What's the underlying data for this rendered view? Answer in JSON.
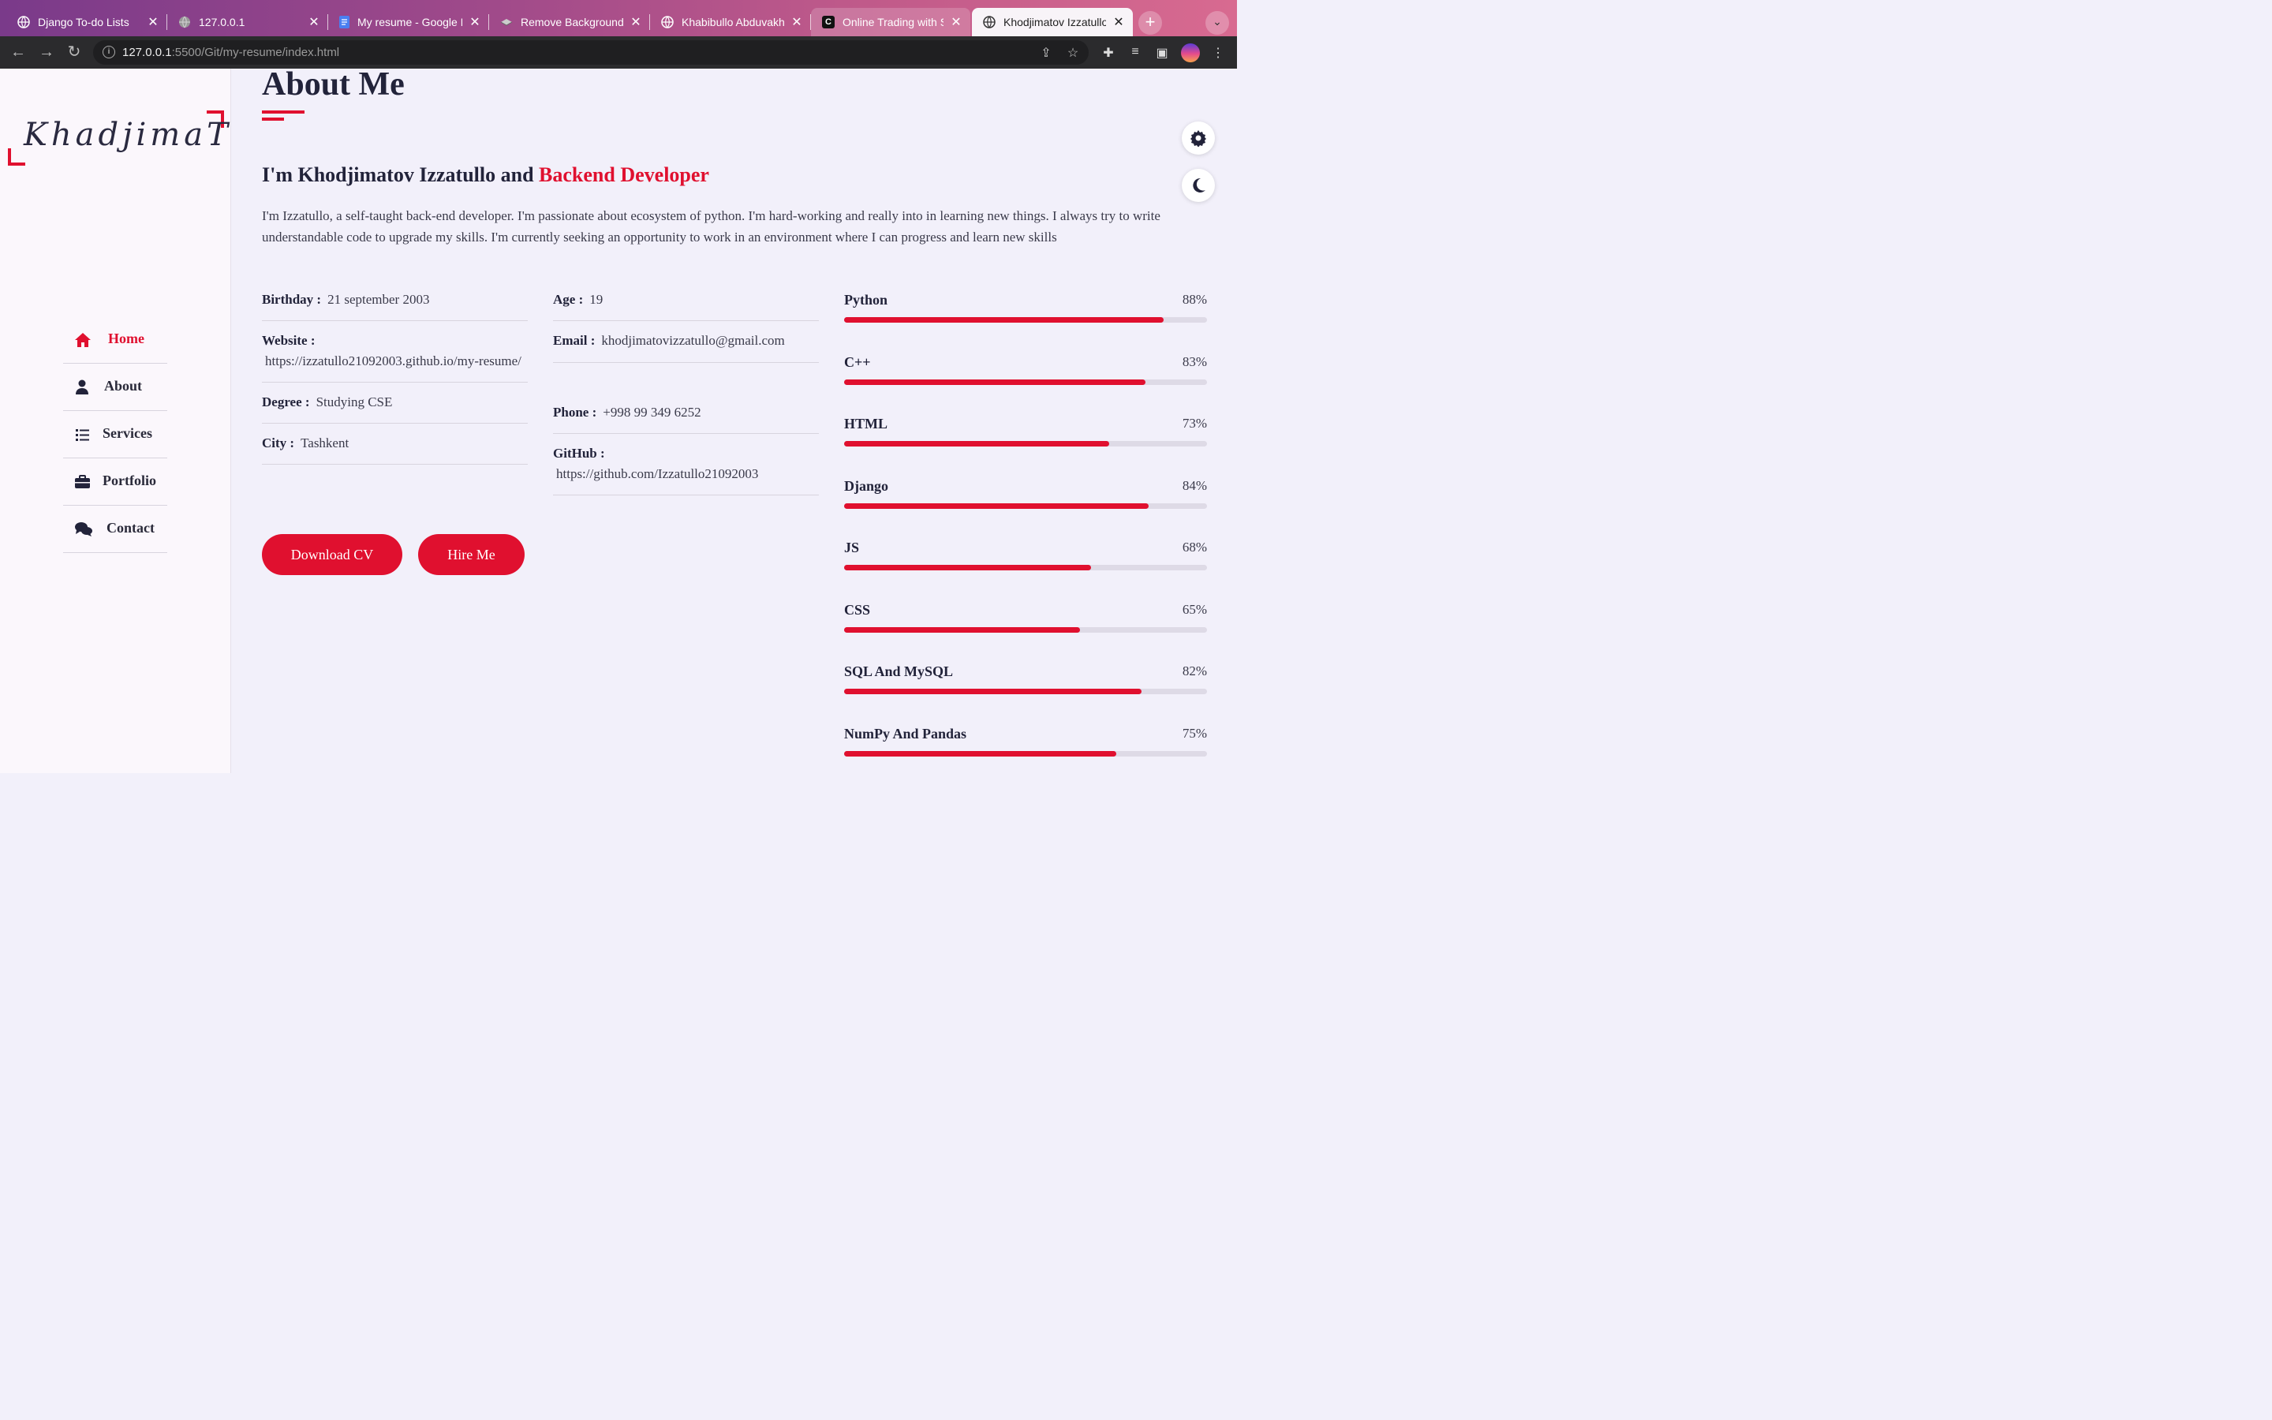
{
  "browser": {
    "tabs": [
      {
        "title": "Django To-do Lists",
        "icon": "globe-icon"
      },
      {
        "title": "127.0.0.1",
        "icon": "globe-icon"
      },
      {
        "title": "My resume - Google Docs",
        "icon": "docs-icon"
      },
      {
        "title": "Remove Background from Image",
        "icon": "layers-icon"
      },
      {
        "title": "Khabibullo Abduvakhobov",
        "icon": "globe-icon"
      },
      {
        "title": "Online Trading with Stocks",
        "icon": "c-icon"
      },
      {
        "title": "Khodjimatov Izzatullo",
        "icon": "globe-icon",
        "active": true
      }
    ],
    "url_host": "127.0.0.1",
    "url_path": ":5500/Git/my-resume/index.html"
  },
  "sidebar": {
    "logo": "KhadjimaT",
    "nav": [
      {
        "label": "Home",
        "icon": "home-icon",
        "active": true
      },
      {
        "label": "About",
        "icon": "user-icon"
      },
      {
        "label": "Services",
        "icon": "list-icon"
      },
      {
        "label": "Portfolio",
        "icon": "briefcase-icon"
      },
      {
        "label": "Contact",
        "icon": "comments-icon"
      }
    ]
  },
  "about": {
    "title": "About Me",
    "headline_prefix": "I'm Khodjimatov Izzatullo and",
    "headline_accent": "Backend Developer",
    "bio": "I'm Izzatullo, a self-taught back-end developer. I'm passionate about ecosystem of python. I'm hard-working and really into in learning new things. I always try to write understandable code to upgrade my skills. I'm currently seeking an opportunity to work in an environment where I can progress and learn new skills",
    "left": [
      {
        "label": "Birthday :",
        "value": "21 september 2003"
      },
      {
        "label": "Website :",
        "value": "https://izzatullo21092003.github.io/my-resume/",
        "block": true
      },
      {
        "label": "Degree :",
        "value": "Studying CSE"
      },
      {
        "label": "City :",
        "value": "Tashkent"
      }
    ],
    "right": [
      {
        "label": "Age :",
        "value": "19"
      },
      {
        "label": "Email :",
        "value": "khodjimatovizzatullo@gmail.com"
      },
      {
        "label": "Phone :",
        "value": "+998 99 349 6252"
      },
      {
        "label": "GitHub :",
        "value": "https://github.com/Izzatullo21092003",
        "block": true
      }
    ],
    "buttons": {
      "download": "Download CV",
      "hire": "Hire Me"
    },
    "skills": [
      {
        "name": "Python",
        "percent": "88%",
        "level": 0.88
      },
      {
        "name": "C++",
        "percent": "83%",
        "level": 0.83
      },
      {
        "name": "HTML",
        "percent": "73%",
        "level": 0.73
      },
      {
        "name": "Django",
        "percent": "84%",
        "level": 0.84
      },
      {
        "name": "JS",
        "percent": "68%",
        "level": 0.68
      },
      {
        "name": "CSS",
        "percent": "65%",
        "level": 0.65
      },
      {
        "name": "SQL And MySQL",
        "percent": "82%",
        "level": 0.82
      },
      {
        "name": "NumPy And Pandas",
        "percent": "75%",
        "level": 0.75
      }
    ]
  },
  "colors": {
    "accent": "#e0102f",
    "text_dark": "#22233a",
    "page_bg": "#f2f0fa",
    "sidebar_bg": "#fbf7fc"
  }
}
